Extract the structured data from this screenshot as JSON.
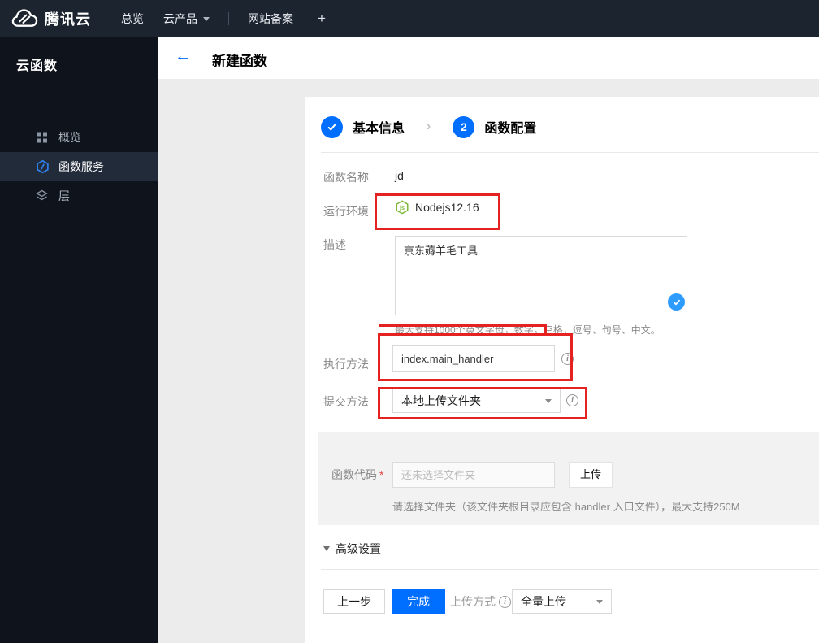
{
  "navbar": {
    "brand": "腾讯云",
    "overview": "总览",
    "products": "云产品",
    "beian": "网站备案",
    "add": "+"
  },
  "sidebar": {
    "title": "云函数",
    "items": [
      {
        "label": "概览",
        "icon": "grid-icon"
      },
      {
        "label": "函数服务",
        "icon": "scf-hexagon-icon"
      },
      {
        "label": "层",
        "icon": "layers-icon"
      }
    ]
  },
  "header": {
    "back": "←",
    "title": "新建函数"
  },
  "steps": {
    "step1_label": "基本信息",
    "step2_number": "2",
    "step2_label": "函数配置",
    "chevron": "›"
  },
  "form": {
    "name_label": "函数名称",
    "name_value": "jd",
    "runtime_label": "运行环境",
    "runtime_value": "Nodejs12.16",
    "desc_label": "描述",
    "desc_value": "京东薅羊毛工具",
    "desc_hint": "最大支持1000个英文字母，数字，空格，逗号、句号、中文。",
    "handler_label": "执行方法",
    "handler_value": "index.main_handler",
    "submit_label": "提交方法",
    "submit_value": "本地上传文件夹",
    "code_label": "函数代码",
    "code_required": "*",
    "code_placeholder": "还未选择文件夹",
    "upload_button": "上传",
    "code_hint": "请选择文件夹（该文件夹根目录应包含 handler 入口文件），最大支持250M",
    "advanced_label": "高级设置",
    "info_glyph": "i"
  },
  "footer": {
    "prev": "上一步",
    "finish": "完成",
    "upload_mode_label": "上传方式",
    "upload_mode_value": "全量上传"
  },
  "colors": {
    "accent_blue": "#006eff",
    "check_blue": "#2e9cff",
    "annotation_red": "#e52222",
    "nodejs_green": "#7fba3d",
    "navbar_bg": "#1c2430",
    "sidebar_bg": "#0e131c",
    "content_bg": "#ececec"
  }
}
